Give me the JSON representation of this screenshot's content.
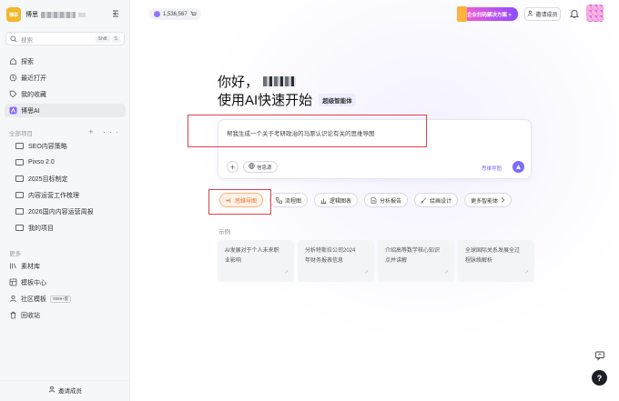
{
  "workspace": {
    "logo_text": "博思",
    "name": "博思"
  },
  "search": {
    "placeholder": "搜索",
    "shortcut_1": "Shift",
    "shortcut_2": "S"
  },
  "nav": [
    {
      "label": "探索",
      "icon": "compass-icon"
    },
    {
      "label": "最近打开",
      "icon": "clock-icon"
    },
    {
      "label": "我的收藏",
      "icon": "tag-icon"
    },
    {
      "label": "博思AI",
      "icon": "ai-icon"
    }
  ],
  "projects": {
    "title": "全部项目",
    "actions": "+ ···",
    "items": [
      "SEO内容策略",
      "Pixso 2.0",
      "2025目标制定",
      "内容运营工作梳理",
      "2026国内内容运营周报",
      "我的项目"
    ]
  },
  "more": {
    "title": "更多",
    "items": [
      {
        "label": "素材库",
        "icon": "library-icon"
      },
      {
        "label": "模板中心",
        "icon": "template-icon"
      },
      {
        "label": "社区模板",
        "icon": "community-icon",
        "badge": "9999+套"
      },
      {
        "label": "回收站",
        "icon": "trash-icon"
      }
    ]
  },
  "sidebar_invite": "邀请成员",
  "header": {
    "credits": "1,536,567",
    "promo": "企业扫码解决方案 >",
    "invite": "邀请成员"
  },
  "hero": {
    "greeting": "你好，",
    "headline": "使用AI快速开始",
    "agent_tag": "超级智能体"
  },
  "prompt": {
    "text": "帮我生成一个关于考研政治的马原认识论有关的思维导图",
    "source_label": "信息源",
    "mode_label": "思维导图"
  },
  "chips": [
    {
      "label": "思维导图",
      "icon": "mindmap-icon",
      "active": true
    },
    {
      "label": "流程图",
      "icon": "flowchart-icon"
    },
    {
      "label": "逻辑图表",
      "icon": "logic-chart-icon"
    },
    {
      "label": "分析报告",
      "icon": "report-icon"
    },
    {
      "label": "绘画设计",
      "icon": "paint-icon"
    },
    {
      "label": "更多智能体",
      "icon": "chevron-right-icon"
    }
  ],
  "examples": {
    "title": "示例",
    "cards": [
      {
        "line1": "AI发展对于个人未来职",
        "line2": "业影响"
      },
      {
        "line1": "分析特斯拉公司2024",
        "line2": "年财务报表信息"
      },
      {
        "line1": "介绍高等数学核心知识",
        "line2": "点并讲解"
      },
      {
        "line1": "全球国际关系发展全过",
        "line2": "程脉络解析"
      }
    ]
  },
  "colors": {
    "accent": "#7c6cff",
    "highlight": "#e0424a",
    "active_chip": "#e8742a"
  }
}
